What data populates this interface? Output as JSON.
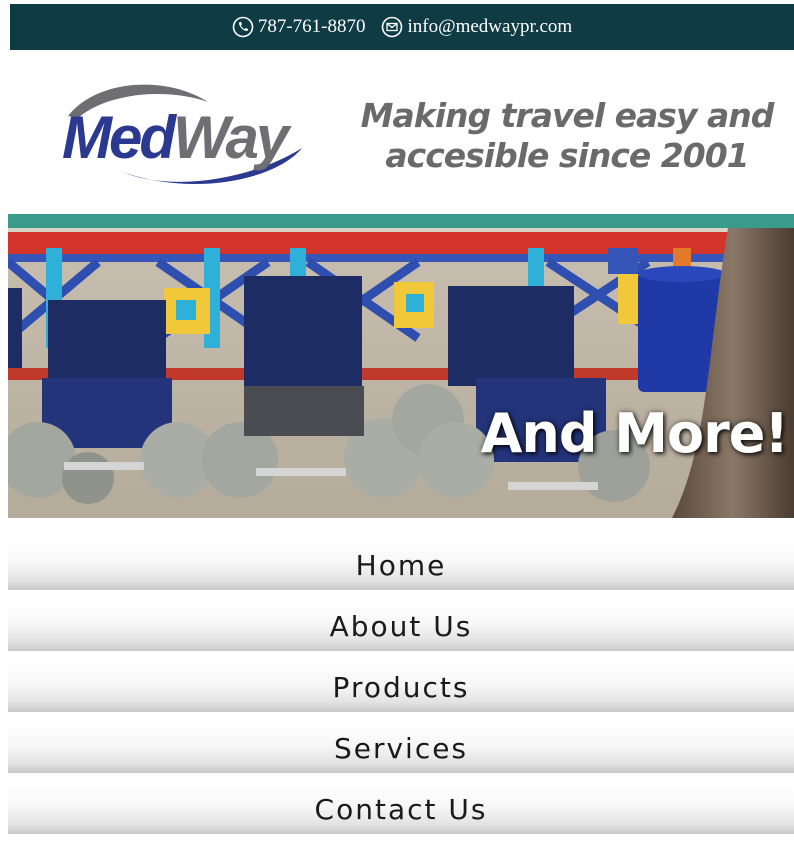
{
  "topbar": {
    "phone_icon": "phone-icon",
    "phone": "787-761-8870",
    "email_icon": "email-icon",
    "email": "info@medwaypr.com"
  },
  "logo": {
    "part1": "Med",
    "part2": "Way"
  },
  "tagline": {
    "line1": "Making travel easy and",
    "line2": "accesible since 2001"
  },
  "banner": {
    "caption": "And More!"
  },
  "nav": {
    "items": [
      {
        "label": "Home"
      },
      {
        "label": "About Us"
      },
      {
        "label": "Products"
      },
      {
        "label": "Services"
      },
      {
        "label": "Contact Us"
      }
    ]
  },
  "colors": {
    "topbar": "#0f3b45",
    "brand_blue": "#2b3990",
    "brand_gray": "#6f6f73",
    "teal_stripe": "#3a9a8c"
  }
}
